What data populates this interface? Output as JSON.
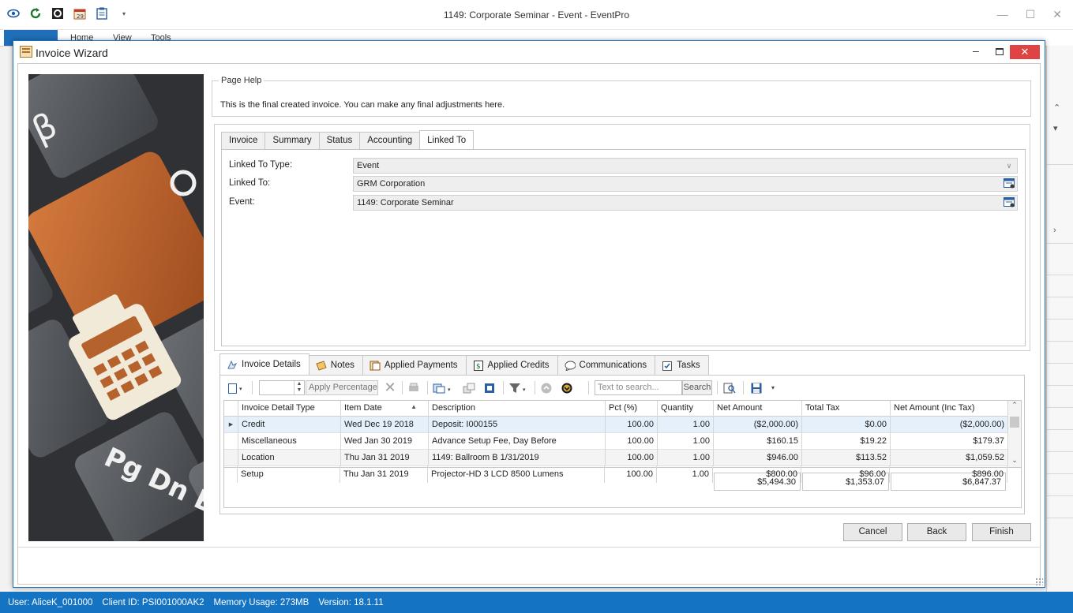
{
  "app": {
    "title": "1149: Corporate Seminar - Event - EventPro",
    "ribbon_tabs": [
      "Home",
      "View",
      "Tools"
    ],
    "accent_color": "#1573c4"
  },
  "dialog": {
    "title": "Invoice Wizard",
    "close_glyph": "✕"
  },
  "page_help": {
    "legend": "Page Help",
    "text": "This is the final created invoice.  You can make any final adjustments here."
  },
  "top_tabs": [
    "Invoice",
    "Summary",
    "Status",
    "Accounting",
    "Linked To"
  ],
  "top_tab_active": "Linked To",
  "linked_to": {
    "type_label": "Linked To Type:",
    "type_value": "Event",
    "linked_label": "Linked To:",
    "linked_value": "GRM Corporation",
    "event_label": "Event:",
    "event_value": "1149: Corporate Seminar"
  },
  "bottom_tabs": [
    {
      "label": "Invoice Details",
      "icon": "invoice-details-icon"
    },
    {
      "label": "Notes",
      "icon": "notes-icon"
    },
    {
      "label": "Applied Payments",
      "icon": "payments-icon"
    },
    {
      "label": "Applied Credits",
      "icon": "credits-icon"
    },
    {
      "label": "Communications",
      "icon": "communications-icon"
    },
    {
      "label": "Tasks",
      "icon": "tasks-icon"
    }
  ],
  "toolbar": {
    "apply_percentage": "Apply Percentage",
    "search_placeholder": "Text to search...",
    "search_button": "Search"
  },
  "grid": {
    "columns": [
      "Invoice Detail Type",
      "Item Date",
      "Description",
      "Pct (%)",
      "Quantity",
      "Net Amount",
      "Total Tax",
      "Net Amount (Inc Tax)"
    ],
    "sort_indicator": "▲",
    "rows": [
      {
        "type": "Credit",
        "date": "Wed Dec 19 2018",
        "desc": "Deposit: I000155",
        "pct": "100.00",
        "qty": "1.00",
        "net": "($2,000.00)",
        "tax": "$0.00",
        "inc": "($2,000.00)"
      },
      {
        "type": "Miscellaneous",
        "date": "Wed Jan 30 2019",
        "desc": "Advance Setup Fee, Day Before",
        "pct": "100.00",
        "qty": "1.00",
        "net": "$160.15",
        "tax": "$19.22",
        "inc": "$179.37"
      },
      {
        "type": "Location",
        "date": "Thu Jan 31 2019",
        "desc": "1149: Ballroom B 1/31/2019",
        "pct": "100.00",
        "qty": "1.00",
        "net": "$946.00",
        "tax": "$113.52",
        "inc": "$1,059.52"
      },
      {
        "type": "Setup",
        "date": "Thu Jan 31 2019",
        "desc": "Projector-HD 3 LCD 8500 Lumens",
        "pct": "100.00",
        "qty": "1.00",
        "net": "$800.00",
        "tax": "$96.00",
        "inc": "$896.00"
      }
    ],
    "totals": {
      "net": "$5,494.30",
      "tax": "$1,353.07",
      "inc": "$6,847.37"
    }
  },
  "buttons": {
    "cancel": "Cancel",
    "back": "Back",
    "finish": "Finish"
  },
  "status": {
    "user": "User: AliceK_001000",
    "client": "Client ID: PSI001000AK2",
    "memory": "Memory Usage: 273MB",
    "version": "Version: 18.1.11"
  },
  "side_image": {
    "keys": [
      "β",
      "Pg Dn E"
    ]
  }
}
